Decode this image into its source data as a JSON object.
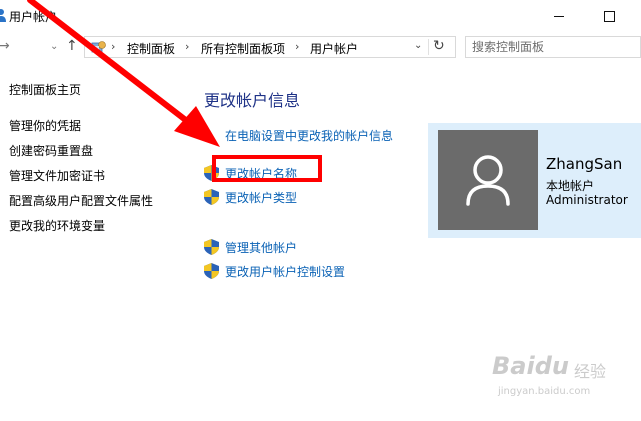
{
  "window": {
    "title": "用户帐户",
    "minimize_glyph": "",
    "maximize_glyph": ""
  },
  "nav": {
    "forward_glyph": "→",
    "dropdown_glyph": "⌄",
    "up_glyph": "↑"
  },
  "address_bar": {
    "crumbs": [
      "控制面板",
      "所有控制面板项",
      "用户帐户"
    ],
    "separator": "›",
    "dropdown_glyph": "⌄",
    "refresh_glyph": "↻"
  },
  "search": {
    "placeholder": "搜索控制面板"
  },
  "sidebar": {
    "items": [
      {
        "label": "控制面板主页"
      },
      {
        "label": "管理你的凭据"
      },
      {
        "label": "创建密码重置盘"
      },
      {
        "label": "管理文件加密证书"
      },
      {
        "label": "配置高级用户配置文件属性"
      },
      {
        "label": "更改我的环境变量"
      }
    ]
  },
  "main": {
    "heading": "更改帐户信息",
    "pc_settings_link": "在电脑设置中更改我的帐户信息",
    "tasks": [
      {
        "label": "更改帐户名称",
        "icon": "uac-shield-icon"
      },
      {
        "label": "更改帐户类型",
        "icon": "uac-shield-icon"
      },
      {
        "label": "管理其他帐户",
        "icon": "uac-shield-icon"
      },
      {
        "label": "更改用户帐户控制设置",
        "icon": "uac-shield-icon"
      }
    ]
  },
  "user": {
    "name": "ZhangSan",
    "account_type": "本地帐户",
    "role": "Administrator",
    "avatar_icon": "user-silhouette-icon"
  },
  "annotation": {
    "color": "#ff0000"
  },
  "watermark": {
    "brand": "Baidu",
    "brand_cn": "经验",
    "url": "jingyan.baidu.com"
  },
  "colors": {
    "link": "#0a62b5",
    "heading": "#1e3287",
    "user_panel_bg": "#ddeefb",
    "avatar_bg": "#6b6b6b"
  }
}
